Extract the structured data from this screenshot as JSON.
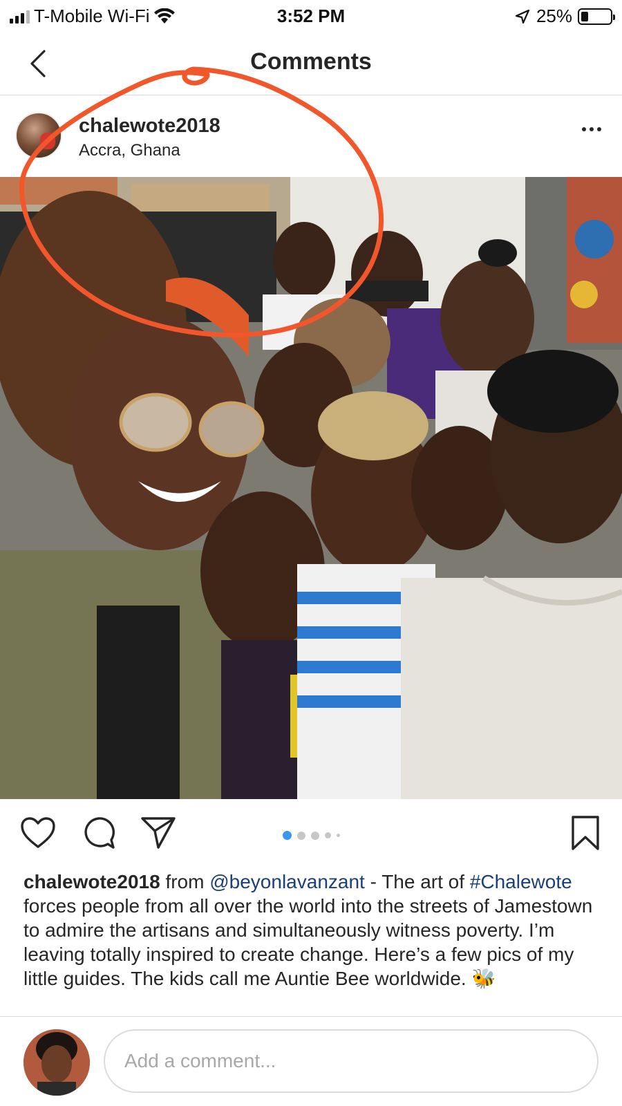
{
  "status_bar": {
    "carrier": "T-Mobile Wi-Fi",
    "time": "3:52 PM",
    "battery": "25%",
    "battery_level": 0.25
  },
  "nav": {
    "title": "Comments",
    "back_icon": "chevron-left-icon"
  },
  "post": {
    "username": "chalewote2018",
    "location": "Accra, Ghana",
    "more_icon": "more-horizontal-icon",
    "carousel": {
      "total": 5,
      "active_index": 0
    }
  },
  "actions": {
    "like_icon": "heart-icon",
    "comment_icon": "comment-bubble-icon",
    "share_icon": "send-icon",
    "save_icon": "bookmark-icon"
  },
  "caption": {
    "username": "chalewote2018",
    "from_word": "from",
    "mention": "@beyonlavanzant",
    "text_before_hashtag": " -  The art of",
    "hashtag": "#Chalewote",
    "text_after_hashtag": " forces people from all over the world into the streets of Jamestown to admire the artisans and simultaneously witness poverty. I’m leaving totally inspired to create change. Here’s a few pics of my little guides. The kids call me Auntie Bee worldwide.",
    "emoji": "🐝"
  },
  "comment_input": {
    "placeholder": "Add a comment..."
  },
  "colors": {
    "annotation_circle": "#f2572c",
    "link": "#1a3f7a",
    "active_dot": "#3897f0",
    "inactive_dot": "#c7c7c7"
  }
}
